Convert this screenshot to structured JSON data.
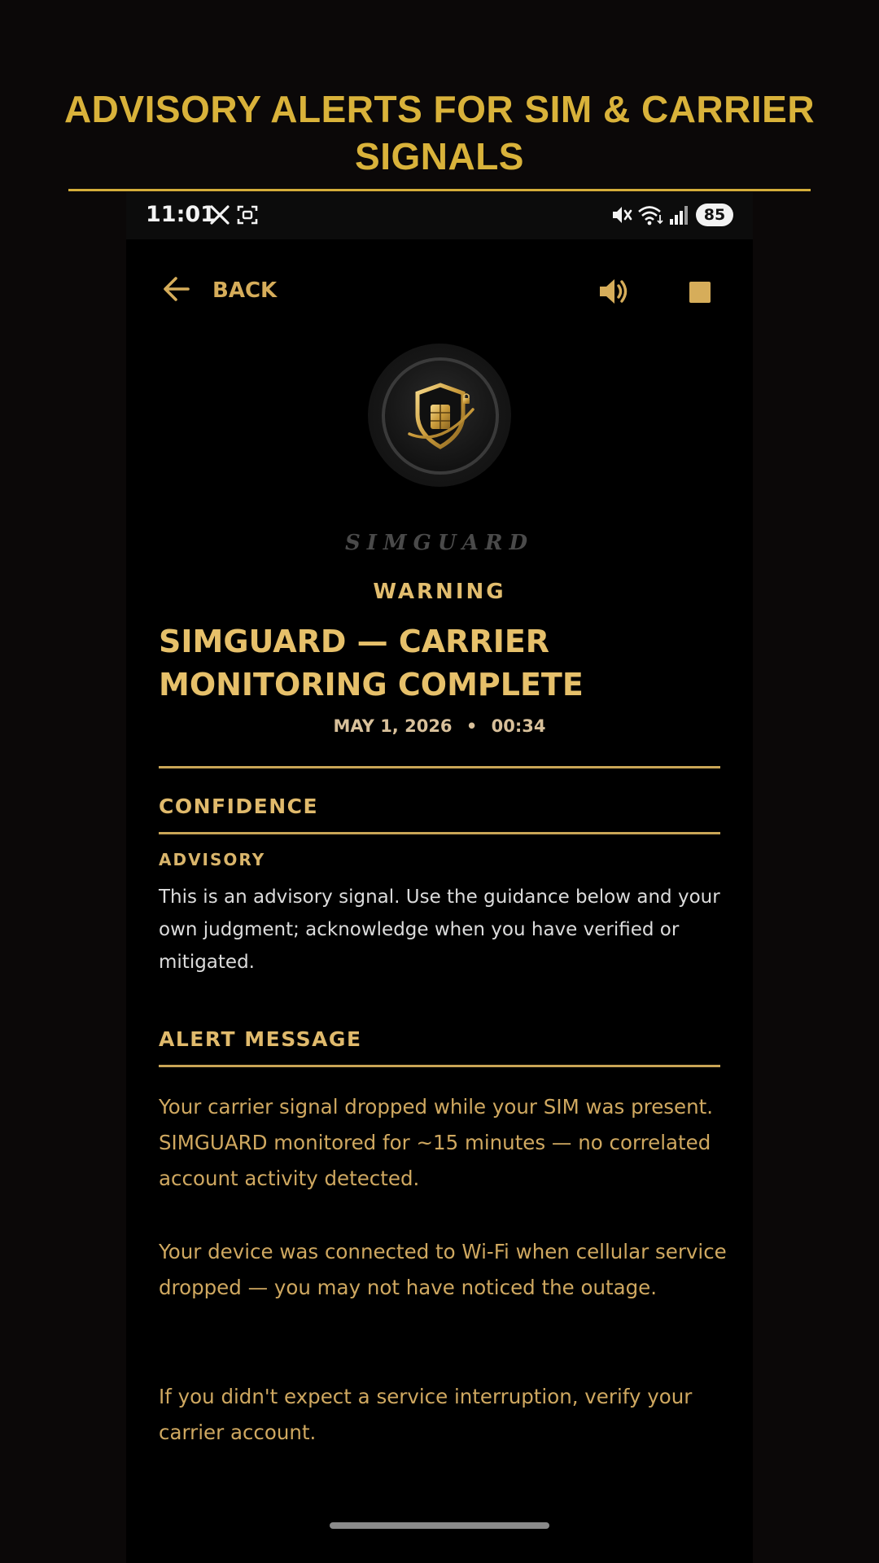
{
  "banner": {
    "title": "ADVISORY ALERTS FOR SIM & CARRIER SIGNALS"
  },
  "status_bar": {
    "time": "11:01",
    "battery": "85",
    "icons": [
      "x-logo-icon",
      "screen-record-icon",
      "mute-icon",
      "wifi-icon",
      "cell-signal-icon"
    ]
  },
  "toolbar": {
    "back_label": "BACK",
    "icons": [
      "arrow-left-icon",
      "speaker-icon",
      "stop-icon"
    ]
  },
  "app": {
    "brand_name": "SIMGUARD",
    "logo_icon": "sim-shield-icon"
  },
  "alert": {
    "severity": "WARNING",
    "title": "SIMGUARD — CARRIER MONITORING COMPLETE",
    "date": "MAY 1, 2026",
    "separator": "•",
    "time": "00:34"
  },
  "confidence": {
    "heading": "CONFIDENCE",
    "level": "ADVISORY",
    "description": "This is an advisory signal. Use the guidance below and your own judgment; acknowledge when you have verified or mitigated."
  },
  "message": {
    "heading": "ALERT MESSAGE",
    "paragraphs": [
      "Your carrier signal dropped while your SIM was present. SIMGUARD monitored for ~15 minutes — no correlated account activity detected.",
      "Your device was connected to Wi-Fi when cellular service dropped — you may not have noticed the outage.",
      "If you didn't expect a service interruption, verify your carrier account."
    ]
  },
  "colors": {
    "gold": "#d9b23a",
    "gold_text": "#cfa860",
    "background": "#000000"
  }
}
